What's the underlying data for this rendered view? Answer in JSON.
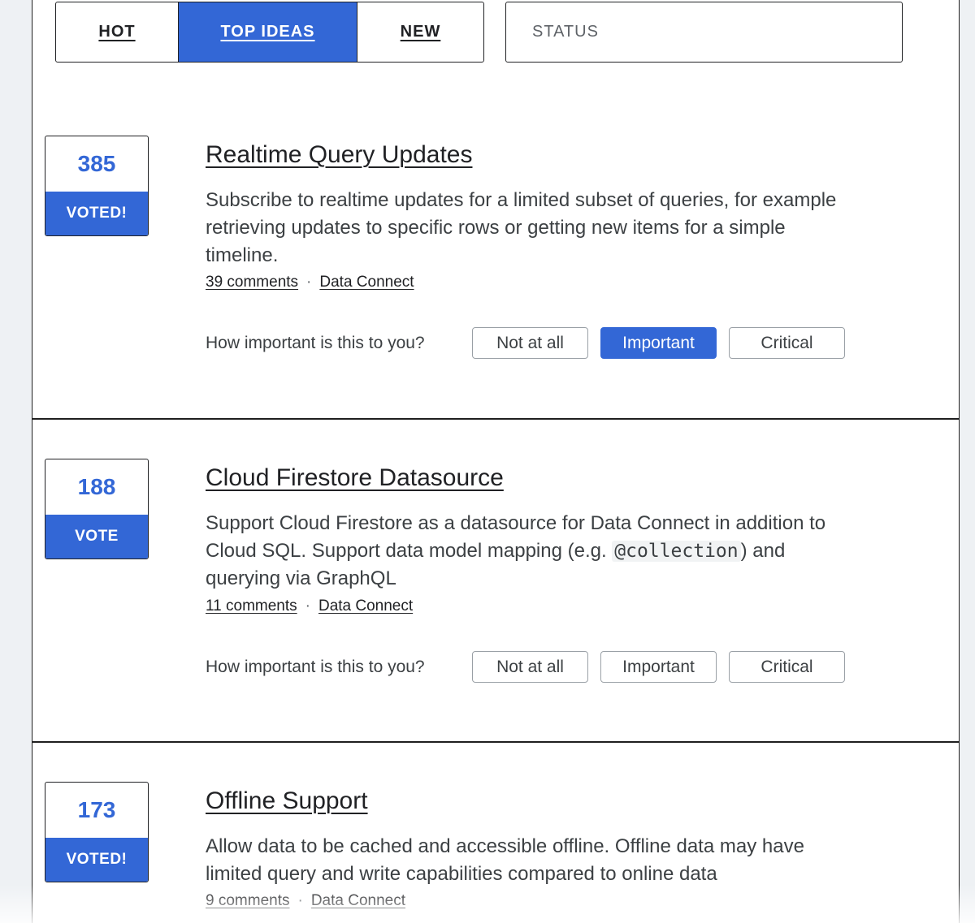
{
  "tabs": [
    "HOT",
    "TOP IDEAS",
    "NEW"
  ],
  "active_tab": "TOP IDEAS",
  "status_select": {
    "placeholder": "STATUS"
  },
  "colors": {
    "accent": "#3367d6",
    "border": "#202124",
    "page_bg": "#eef1f4"
  },
  "importance_prompt": "How important is this to you?",
  "importance_options": [
    "Not at all",
    "Important",
    "Critical"
  ],
  "ideas": [
    {
      "votes": "385",
      "vote_label": "VOTED!",
      "title": "Realtime Query Updates",
      "description": "Subscribe to realtime updates for a limited subset of queries, for example retrieving updates to specific rows or getting new items for a simple timeline.",
      "comments": "39 comments",
      "category": "Data Connect",
      "selected_importance": "Important"
    },
    {
      "votes": "188",
      "vote_label": "VOTE",
      "title": "Cloud Firestore Datasource",
      "description_before": "Support Cloud Firestore as a datasource for Data Connect in addition to Cloud SQL. Support data model mapping (e.g. ",
      "description_code": "@collection",
      "description_after": ") and querying via GraphQL",
      "comments": "11 comments",
      "category": "Data Connect",
      "selected_importance": ""
    },
    {
      "votes": "173",
      "vote_label": "VOTED!",
      "title": "Offline Support",
      "description": "Allow data to be cached and accessible offline. Offline data may have limited query and write capabilities compared to online data",
      "comments": "9 comments",
      "category": "Data Connect",
      "selected_importance": ""
    }
  ]
}
